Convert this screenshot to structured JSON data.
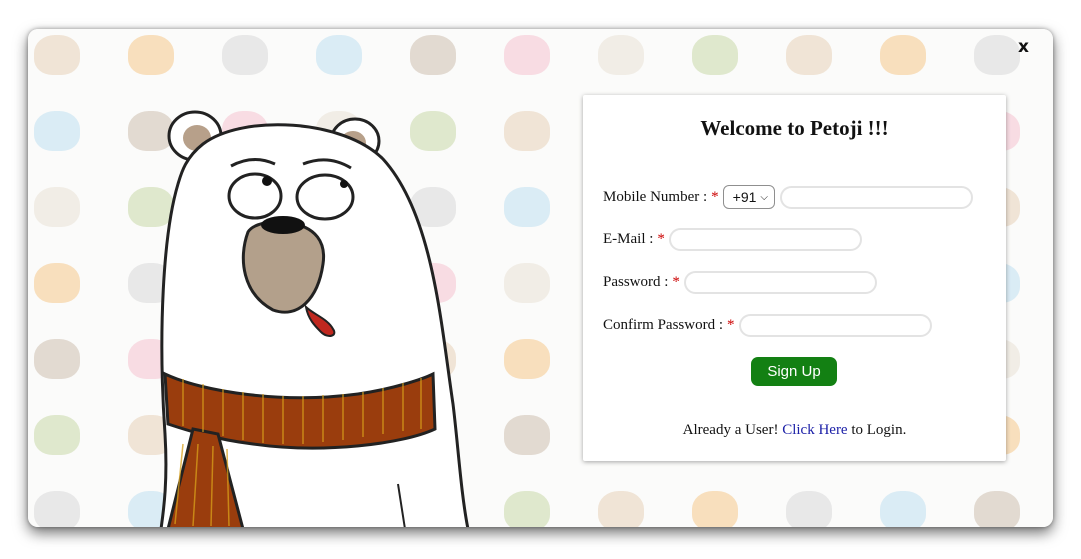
{
  "modal": {
    "close_label": "x"
  },
  "form": {
    "title": "Welcome to Petoji !!!",
    "mobile": {
      "label": "Mobile Number :",
      "required_mark": "*",
      "country_code": "+91",
      "value": ""
    },
    "email": {
      "label": "E-Mail :",
      "required_mark": "*",
      "value": ""
    },
    "password": {
      "label": "Password :",
      "required_mark": "*",
      "value": ""
    },
    "confirm_password": {
      "label": "Confirm Password :",
      "required_mark": "*",
      "value": ""
    },
    "submit_label": "Sign Up",
    "login_prefix": "Already a User!",
    "login_link": "Click Here",
    "login_suffix": "to Login."
  },
  "colors": {
    "signup_button": "#138013",
    "required_mark": "#cc0000",
    "link": "#1d21a8"
  },
  "icons": {
    "close": "close-icon",
    "dropdown": "chevron-down-icon",
    "illustration": "polar-bear-illustration"
  }
}
